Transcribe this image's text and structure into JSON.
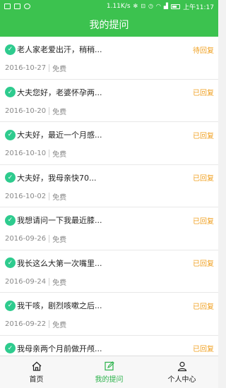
{
  "status_bar": {
    "network_speed": "1.11K/s",
    "time": "上午11:17"
  },
  "header": {
    "title": "我的提问"
  },
  "questions": [
    {
      "text": "老人家老爱出汗，稍稍...",
      "status": "待回复",
      "date": "2016-10-27",
      "price": "免费"
    },
    {
      "text": "大夫您好，老婆怀孕两...",
      "status": "已回复",
      "date": "2016-10-20",
      "price": "免费"
    },
    {
      "text": "大夫好，最近一个月感...",
      "status": "已回复",
      "date": "2016-10-10",
      "price": "免费"
    },
    {
      "text": "大夫好，我母亲快70...",
      "status": "已回复",
      "date": "2016-10-02",
      "price": "免费"
    },
    {
      "text": "我想请问一下我最近膝...",
      "status": "已回复",
      "date": "2016-09-26",
      "price": "免费"
    },
    {
      "text": "我长这么大第一次嘴里...",
      "status": "已回复",
      "date": "2016-09-24",
      "price": "免费"
    },
    {
      "text": "我干咳，剧烈咳嗽之后...",
      "status": "已回复",
      "date": "2016-09-22",
      "price": "免费"
    },
    {
      "text": "我母亲两个月前做开颅...",
      "status": "已回复",
      "date": "",
      "price": ""
    }
  ],
  "tabs": [
    {
      "label": "首页",
      "icon": "home-icon"
    },
    {
      "label": "我的提问",
      "icon": "edit-icon",
      "active": true
    },
    {
      "label": "个人中心",
      "icon": "user-icon"
    }
  ],
  "colors": {
    "brand_green": "#3cc24f",
    "pending_orange": "#f0a020",
    "bubble_teal": "#2ecb8e"
  }
}
